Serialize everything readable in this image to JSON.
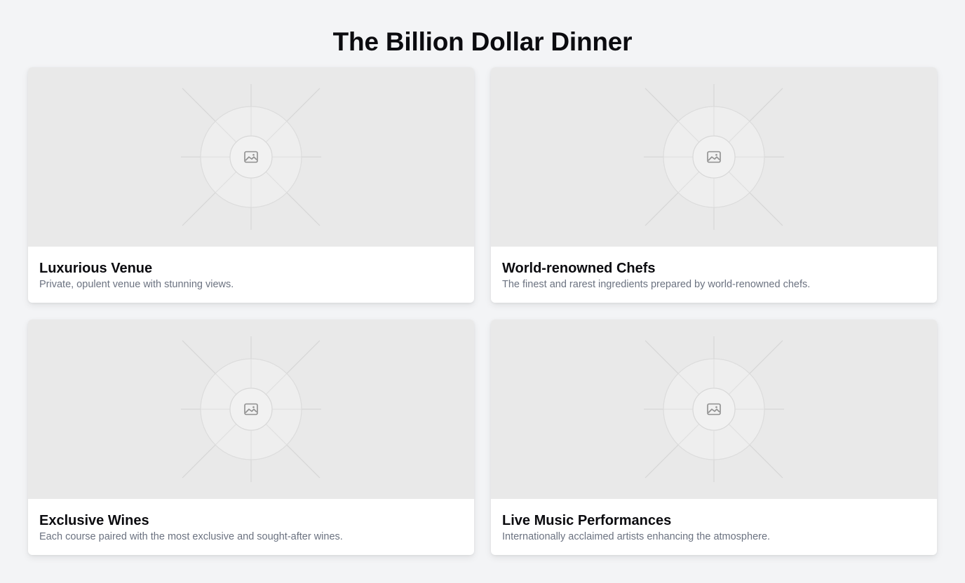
{
  "page": {
    "title": "The Billion Dollar Dinner"
  },
  "cards": [
    {
      "title": "Luxurious Venue",
      "description": "Private, opulent venue with stunning views.",
      "image_icon": "image-placeholder-icon"
    },
    {
      "title": "World-renowned Chefs",
      "description": "The finest and rarest ingredients prepared by world-renowned chefs.",
      "image_icon": "image-placeholder-icon"
    },
    {
      "title": "Exclusive Wines",
      "description": "Each course paired with the most exclusive and sought-after wines.",
      "image_icon": "image-placeholder-icon"
    },
    {
      "title": "Live Music Performances",
      "description": "Internationally acclaimed artists enhancing the atmosphere.",
      "image_icon": "image-placeholder-icon"
    }
  ],
  "colors": {
    "background": "#f3f4f6",
    "card": "#ffffff",
    "image_placeholder": "#e9e9e9",
    "title_text": "#0b0b0f",
    "muted_text": "#6b7280"
  }
}
